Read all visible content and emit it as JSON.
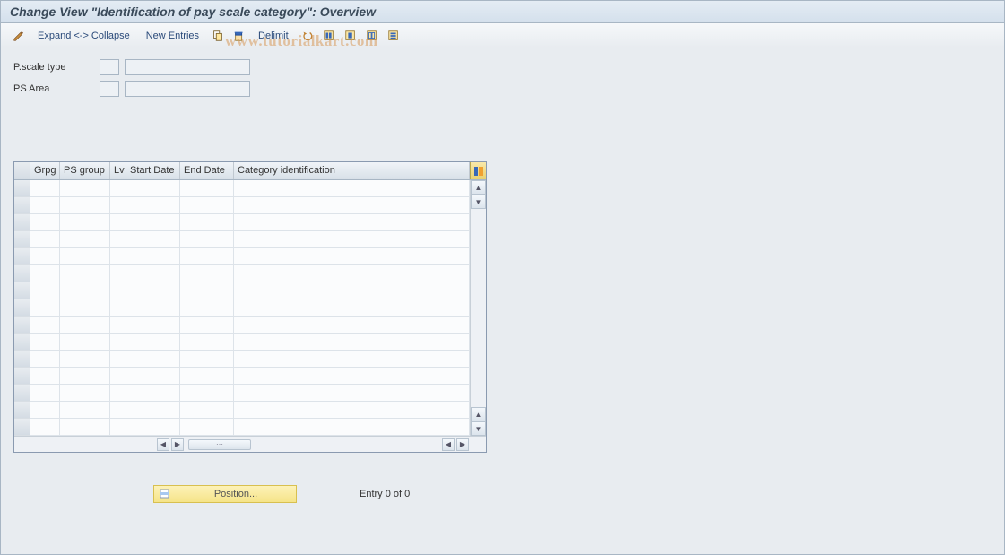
{
  "title": "Change View \"Identification of pay scale category\": Overview",
  "toolbar": {
    "expand_collapse": "Expand <-> Collapse",
    "new_entries": "New Entries",
    "delimit": "Delimit"
  },
  "form": {
    "pscale_type_label": "P.scale type",
    "pscale_type_code": "",
    "pscale_type_desc": "",
    "ps_area_label": "PS Area",
    "ps_area_code": "",
    "ps_area_desc": ""
  },
  "watermark": "www.tutorialkart.com",
  "grid": {
    "columns": {
      "grpg": "Grpg",
      "ps_group": "PS group",
      "lv": "Lv",
      "start_date": "Start Date",
      "end_date": "End Date",
      "category_id": "Category identification"
    },
    "rows": []
  },
  "footer": {
    "position_label": "Position...",
    "entry_text": "Entry 0 of 0"
  }
}
